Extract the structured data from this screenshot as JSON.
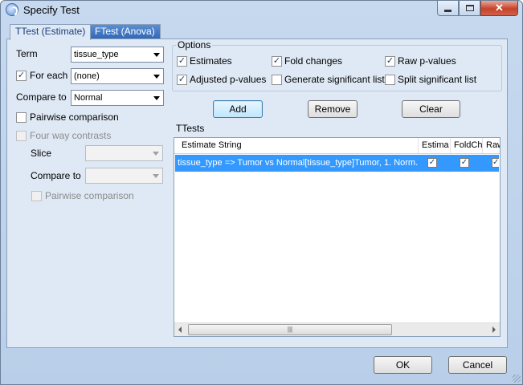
{
  "window": {
    "title": "Specify Test"
  },
  "tabs": [
    {
      "label": "TTest (Estimate)",
      "active": true
    },
    {
      "label": "FTest (Anova)",
      "active": false
    }
  ],
  "left": {
    "term_label": "Term",
    "term_value": "tissue_type",
    "for_each_label": "For each",
    "for_each_checked": true,
    "for_each_value": "(none)",
    "compare_to_label": "Compare to",
    "compare_to_value": "Normal",
    "pairwise_label": "Pairwise comparison",
    "pairwise_checked": false,
    "four_way_label": "Four way contrasts",
    "four_way_checked": false,
    "slice_label": "Slice",
    "slice_value": "",
    "compare_to2_label": "Compare to",
    "compare_to2_value": "",
    "pairwise2_label": "Pairwise comparison",
    "pairwise2_checked": false
  },
  "options": {
    "title": "Options",
    "estimates": "Estimates",
    "fold_changes": "Fold changes",
    "raw_pvalues": "Raw p-values",
    "adjusted_pvalues": "Adjusted p-values",
    "generate_sig": "Generate significant list",
    "split_sig": "Split significant list",
    "checked": {
      "estimates": true,
      "fold_changes": true,
      "raw_pvalues": true,
      "adjusted_pvalues": true,
      "generate_sig": false,
      "split_sig": false
    }
  },
  "actions": {
    "add": "Add",
    "remove": "Remove",
    "clear": "Clear"
  },
  "ttests": {
    "title": "TTests",
    "columns": [
      "Estimate String",
      "Estima",
      "FoldCh",
      "Raw"
    ],
    "rows": [
      {
        "estimate_string": "tissue_type => Tumor vs Normal[tissue_type]Tumor, 1. Norm...",
        "estimate": true,
        "foldchange": true,
        "raw": true
      }
    ]
  },
  "footer": {
    "ok": "OK",
    "cancel": "Cancel"
  },
  "glyphs": {
    "check": "✓",
    "close": "✕",
    "grip": "|||"
  }
}
